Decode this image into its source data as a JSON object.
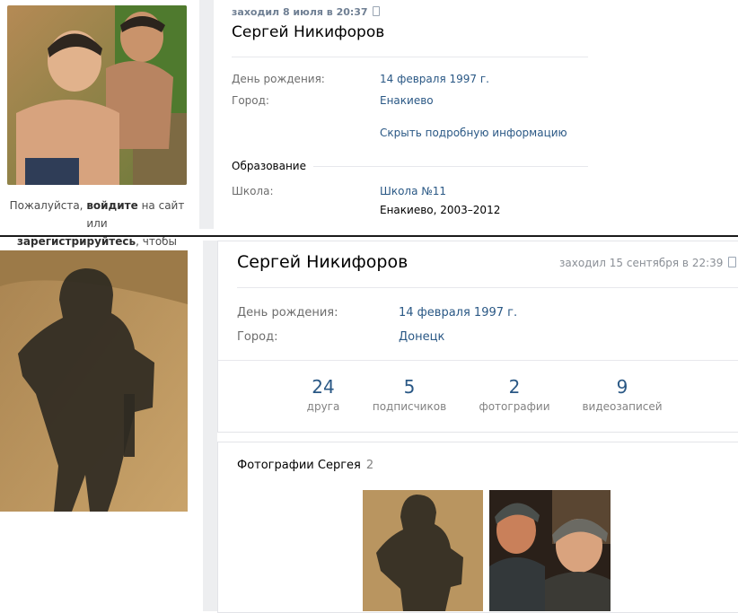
{
  "top": {
    "last_seen": "заходил 8 июля в 20:37",
    "name": "Сергей Никифоров",
    "birthday_label": "День рождения:",
    "birthday_value": "14 февраля 1997 г.",
    "city_label": "Город:",
    "city_value": "Енакиево",
    "hide_info_link": "Скрыть подробную информацию",
    "education_title": "Образование",
    "school_label": "Школа:",
    "school_value": "Школа №11",
    "school_details": "Енакиево, 2003–2012",
    "login_prefix": "Пожалуйста, ",
    "login_link": "войдите",
    "login_middle": " на сайт или",
    "register_link": "зарегистрируйтесь",
    "login_suffix": ", чтобы"
  },
  "bottom": {
    "name": "Сергей Никифоров",
    "last_seen": "заходил 15 сентября в 22:39",
    "birthday_label": "День рождения:",
    "birthday_value": "14 февраля 1997 г.",
    "city_label": "Город:",
    "city_value": "Донецк",
    "counters": [
      {
        "value": "24",
        "label": "друга"
      },
      {
        "value": "5",
        "label": "подписчиков"
      },
      {
        "value": "2",
        "label": "фотографии"
      },
      {
        "value": "9",
        "label": "видеозаписей"
      }
    ],
    "photos_title": "Фотографии Сергея",
    "photos_count": "2"
  },
  "icons": [
    "phone-icon"
  ],
  "colors": {
    "link": "#2a5885",
    "gutter": "#edeef0",
    "muted": "#828282"
  }
}
